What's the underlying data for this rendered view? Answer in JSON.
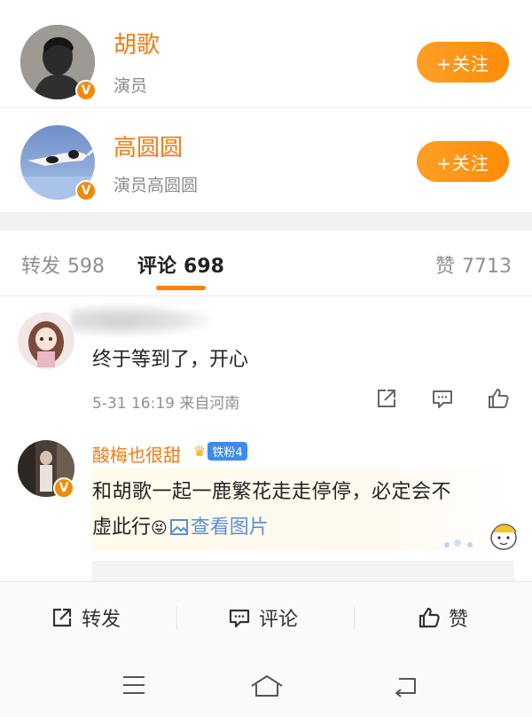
{
  "users": [
    {
      "name": "胡歌",
      "desc": "演员",
      "follow_label": "+关注",
      "verified_badge": "V"
    },
    {
      "name": "高圆圆",
      "desc": "演员高圆圆",
      "follow_label": "+关注",
      "verified_badge": "V"
    }
  ],
  "tabs": {
    "repost": {
      "label": "转发",
      "count": "598"
    },
    "comment": {
      "label": "评论",
      "count": "698"
    },
    "like": {
      "label": "赞",
      "count": "7713"
    }
  },
  "comments": [
    {
      "text": "终于等到了，开心",
      "meta": "5-31 16:19 来自河南"
    },
    {
      "name": "酸梅也很甜",
      "fan_badge": "铁粉4",
      "verified_badge": "V",
      "text_line1": "和胡歌一起一鹿繁花走走停停，必定会不",
      "text_line2": "虚此行",
      "emoji": "😝",
      "see_picture": "查看图片"
    }
  ],
  "bottom_bar": {
    "repost": "转发",
    "comment": "评论",
    "like": "赞"
  },
  "colors": {
    "accent": "#ff8200",
    "name": "#f07b12",
    "link": "#5b8fd8"
  }
}
